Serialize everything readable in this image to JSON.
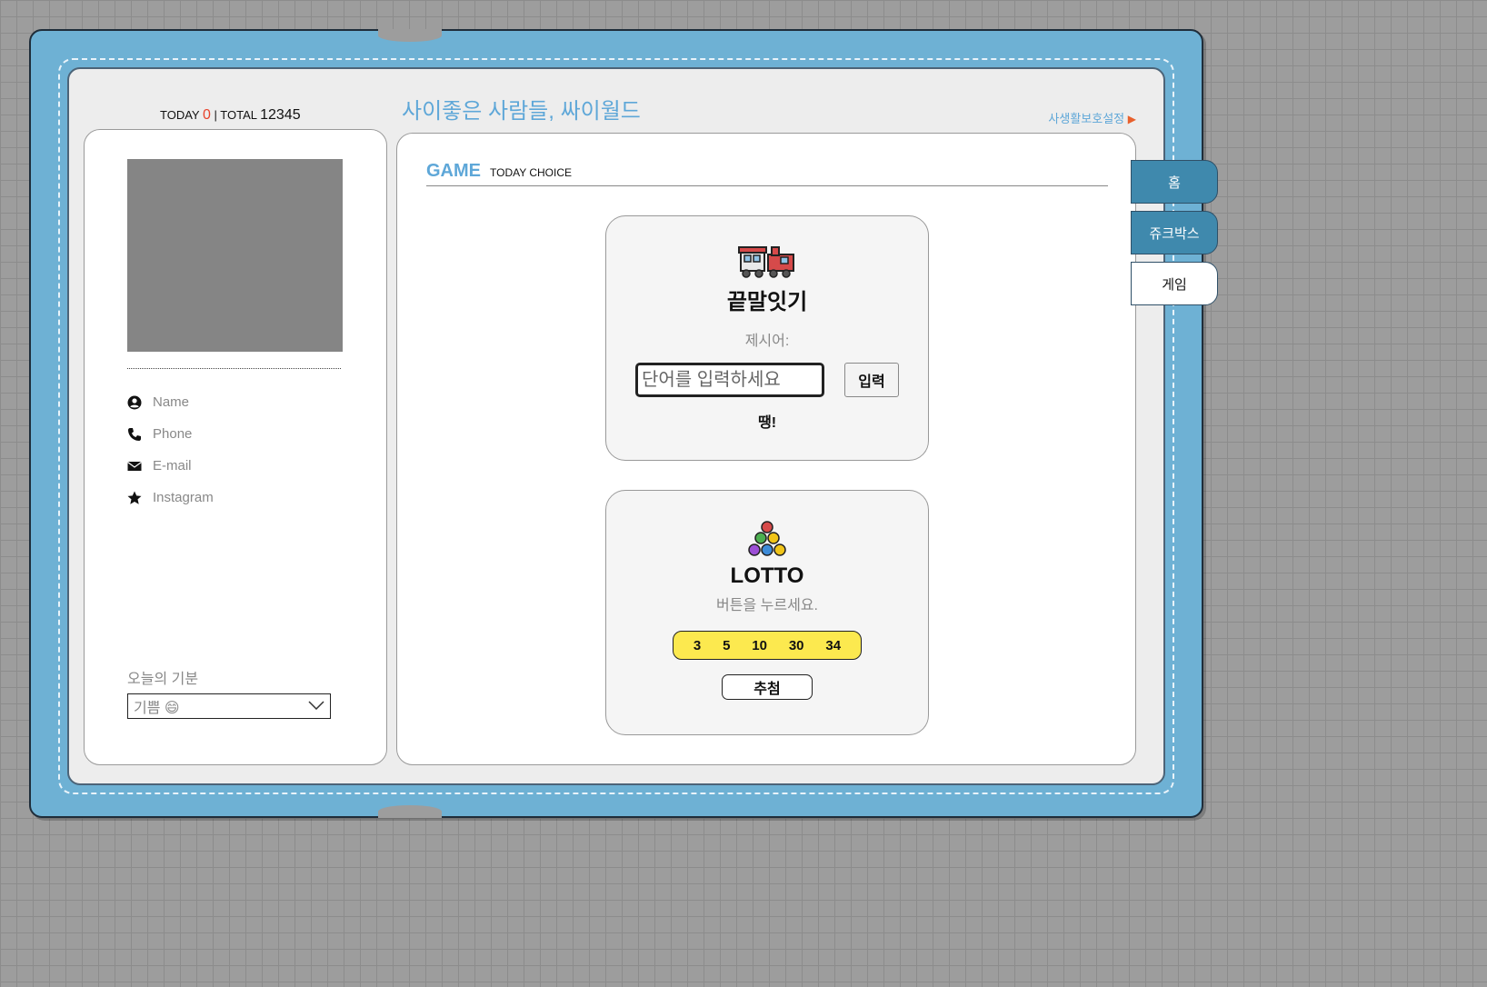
{
  "header": {
    "today_label": "TODAY",
    "today_count": "0",
    "total_label": "| TOTAL",
    "total_count": "12345",
    "site_title": "사이좋은 사람들, 싸이월드",
    "privacy_link": "사생활보호설정",
    "privacy_arrow": "▶"
  },
  "profile": {
    "fields": [
      {
        "icon": "user-circle-icon",
        "label": "Name"
      },
      {
        "icon": "phone-icon",
        "label": "Phone"
      },
      {
        "icon": "envelope-icon",
        "label": "E-mail"
      },
      {
        "icon": "star-icon",
        "label": "Instagram"
      }
    ],
    "mood": {
      "label": "오늘의 기분",
      "selected": "기쁨 😄"
    }
  },
  "main": {
    "section_title": "GAME",
    "section_subtitle": "TODAY CHOICE",
    "word_game": {
      "icon": "train-icon",
      "title": "끝말잇기",
      "suggest_label": "제시어:",
      "input_placeholder": "단어를 입력하세요",
      "input_value": "",
      "enter_label": "입력",
      "result": "땡!"
    },
    "lotto": {
      "icon": "lotto-balls-icon",
      "title": "LOTTO",
      "hint": "버튼을 누르세요.",
      "numbers": [
        "3",
        "5",
        "10",
        "30",
        "34"
      ],
      "draw_label": "추첨"
    }
  },
  "tabs": [
    {
      "label": "홈",
      "active": true
    },
    {
      "label": "쥬크박스",
      "active": true
    },
    {
      "label": "게임",
      "active": false
    }
  ],
  "colors": {
    "accent_blue": "#5ea7d8",
    "book_blue": "#6eb1d4",
    "tab_blue": "#3f89ad",
    "today_red": "#e8432c",
    "lotto_yellow": "#fce94f"
  }
}
